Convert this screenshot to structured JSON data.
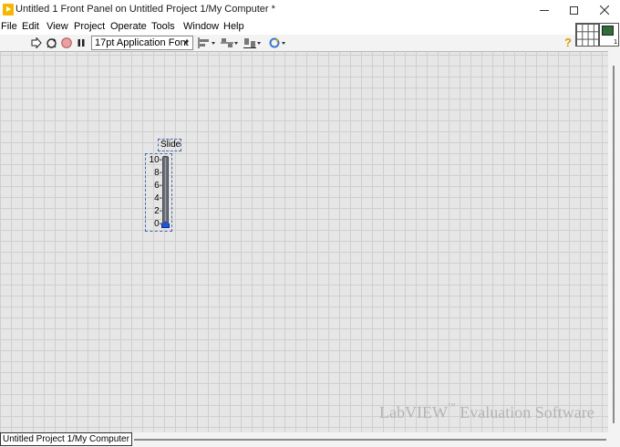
{
  "window": {
    "title": "Untitled 1 Front Panel on Untitled Project 1/My Computer *"
  },
  "menu": {
    "items": [
      "File",
      "Edit",
      "View",
      "Project",
      "Operate",
      "Tools",
      "Window",
      "Help"
    ]
  },
  "toolbar": {
    "font": "17pt Application Font",
    "icons": [
      "run-arrow-icon",
      "run-continuously-icon",
      "abort-stop-icon",
      "pause-icon",
      "align-objects-icon",
      "distribute-objects-icon",
      "resize-objects-icon",
      "reorder-icon",
      "help-icon"
    ]
  },
  "vi_icon": {
    "number": "1"
  },
  "slide": {
    "label": "Slide",
    "ticks": [
      "10",
      "8",
      "6",
      "4",
      "2",
      "0"
    ],
    "value": 0,
    "min": 0,
    "max": 10,
    "thumb_color": "#1f55d8"
  },
  "watermark": {
    "brand": "LabVIEW",
    "tm": "™",
    "rest": "Evaluation Software"
  },
  "status": {
    "context": "Untitled Project 1/My Computer"
  }
}
